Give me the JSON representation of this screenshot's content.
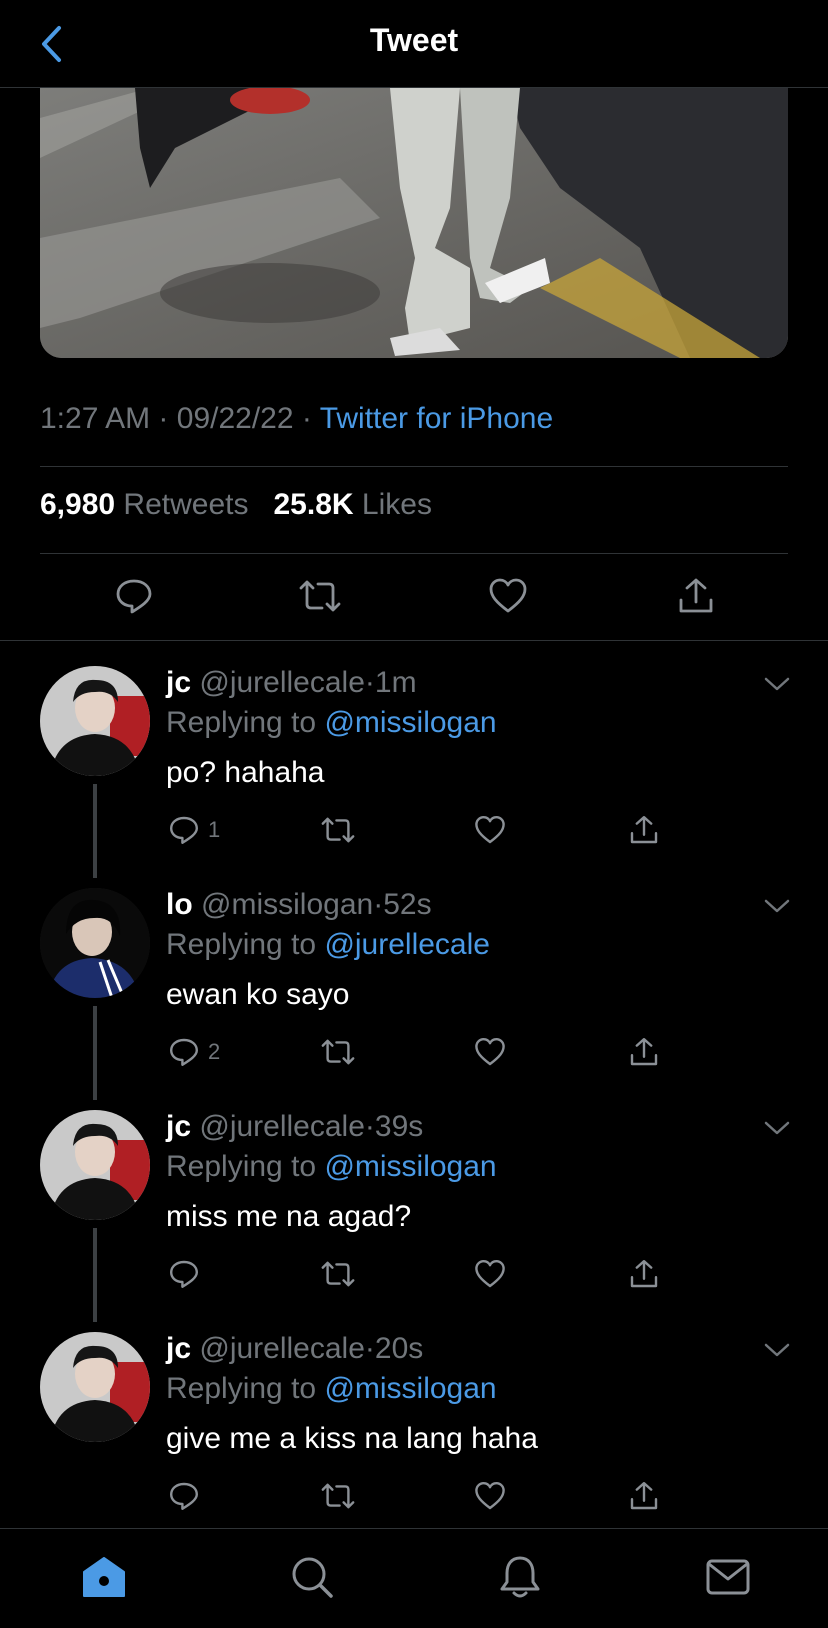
{
  "header": {
    "title": "Tweet",
    "back_icon": "back-chevron-icon"
  },
  "tweet": {
    "time": "1:27 AM",
    "sep1": "·",
    "date": "09/22/22",
    "sep2": "·",
    "source": "Twitter for iPhone",
    "retweets_count": "6,980",
    "retweets_label": "Retweets",
    "likes_count": "25.8K",
    "likes_label": "Likes"
  },
  "replies": [
    {
      "name": "jc",
      "handle": "@jurellecale",
      "dot": "·",
      "time": "1m",
      "replying_label": "Replying to",
      "replying_to": "@missilogan",
      "text": "po? hahaha",
      "reply_count": "1"
    },
    {
      "name": "lo",
      "handle": "@missilogan",
      "dot": "·",
      "time": "52s",
      "replying_label": "Replying to",
      "replying_to": "@jurellecale",
      "text": "ewan ko sayo",
      "reply_count": "2"
    },
    {
      "name": "jc",
      "handle": "@jurellecale",
      "dot": "·",
      "time": "39s",
      "replying_label": "Replying to",
      "replying_to": "@missilogan",
      "text": "miss me na agad?",
      "reply_count": ""
    },
    {
      "name": "jc",
      "handle": "@jurellecale",
      "dot": "·",
      "time": "20s",
      "replying_label": "Replying to",
      "replying_to": "@missilogan",
      "text": "give me a kiss na lang haha",
      "reply_count": ""
    }
  ],
  "tabs": [
    "home-icon",
    "search-icon",
    "notifications-icon",
    "messages-icon"
  ],
  "colors": {
    "accent": "#4b9ae5",
    "muted": "#71767b",
    "divider": "#2f3336",
    "background": "#000000"
  }
}
